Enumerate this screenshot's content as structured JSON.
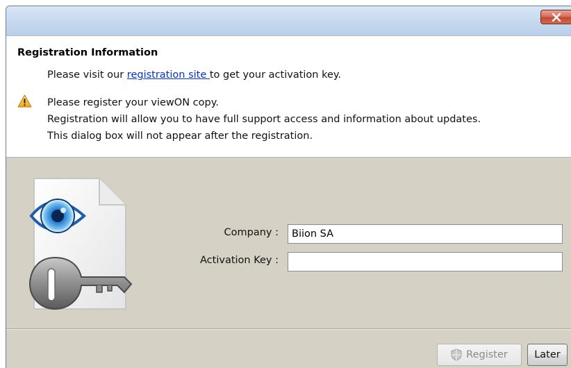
{
  "dialog": {
    "close_label": "×"
  },
  "info": {
    "title": "Registration Information",
    "visit_prefix": "Please visit our ",
    "visit_link": "registration site ",
    "visit_suffix": "to get your activation key.",
    "warning_lines": [
      "Please register your viewON copy.",
      "Registration will allow you to have full support access and information about updates.",
      "This dialog box will not appear after the registration."
    ]
  },
  "form": {
    "company_label": "Company :",
    "company_value": "Biion SA",
    "activation_label": "Activation Key :",
    "activation_value": ""
  },
  "buttons": {
    "register_label": "Register",
    "later_label": "Later"
  },
  "colors": {
    "link": "#0033cc",
    "form_background": "#d5d1c5",
    "close_button": "#c14a33"
  },
  "icons": {
    "close": "close-x-icon",
    "warning": "warning-triangle-icon",
    "logo": "eye-key-document-icon",
    "shield": "uac-shield-icon"
  }
}
